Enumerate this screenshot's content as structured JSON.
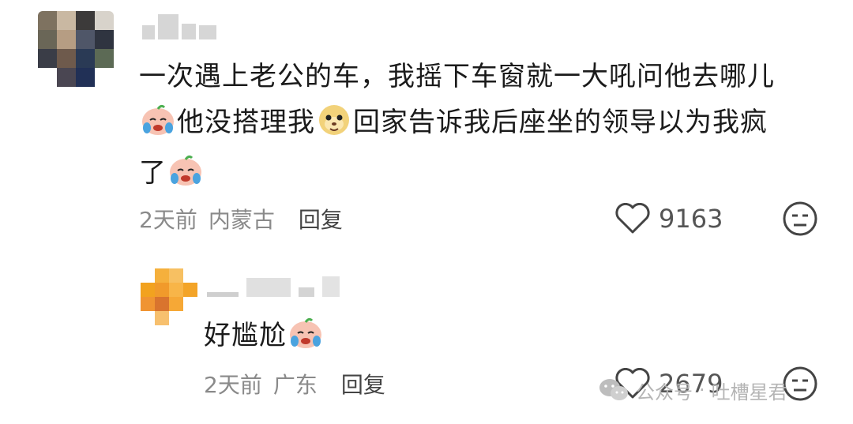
{
  "comments": [
    {
      "text_parts": [
        "一次遇上老公的车，我摇下车窗就一大吼问他去哪儿",
        "他没搭理我",
        "回家告诉我后座坐的领导以为我疯",
        "了"
      ],
      "emojis": [
        "crying-face-emoji",
        "monkey-face-emoji",
        "crying-face-emoji"
      ],
      "time": "2天前",
      "location": "内蒙古",
      "reply_label": "回复",
      "likes": "9163"
    },
    {
      "text": "好尴尬",
      "emojis": [
        "crying-face-emoji"
      ],
      "time": "2天前",
      "location": "广东",
      "reply_label": "回复",
      "likes": "2679"
    }
  ],
  "watermark": {
    "prefix": "公众号",
    "account": "吐槽星君"
  },
  "colors": {
    "like_heart": "#444444",
    "meta_text": "#8a8a8a",
    "main_text": "#1b1b1b",
    "avatar2": "#f2a21f"
  },
  "icons": [
    "heart-icon",
    "neutral-face-icon",
    "wechat-icon"
  ]
}
